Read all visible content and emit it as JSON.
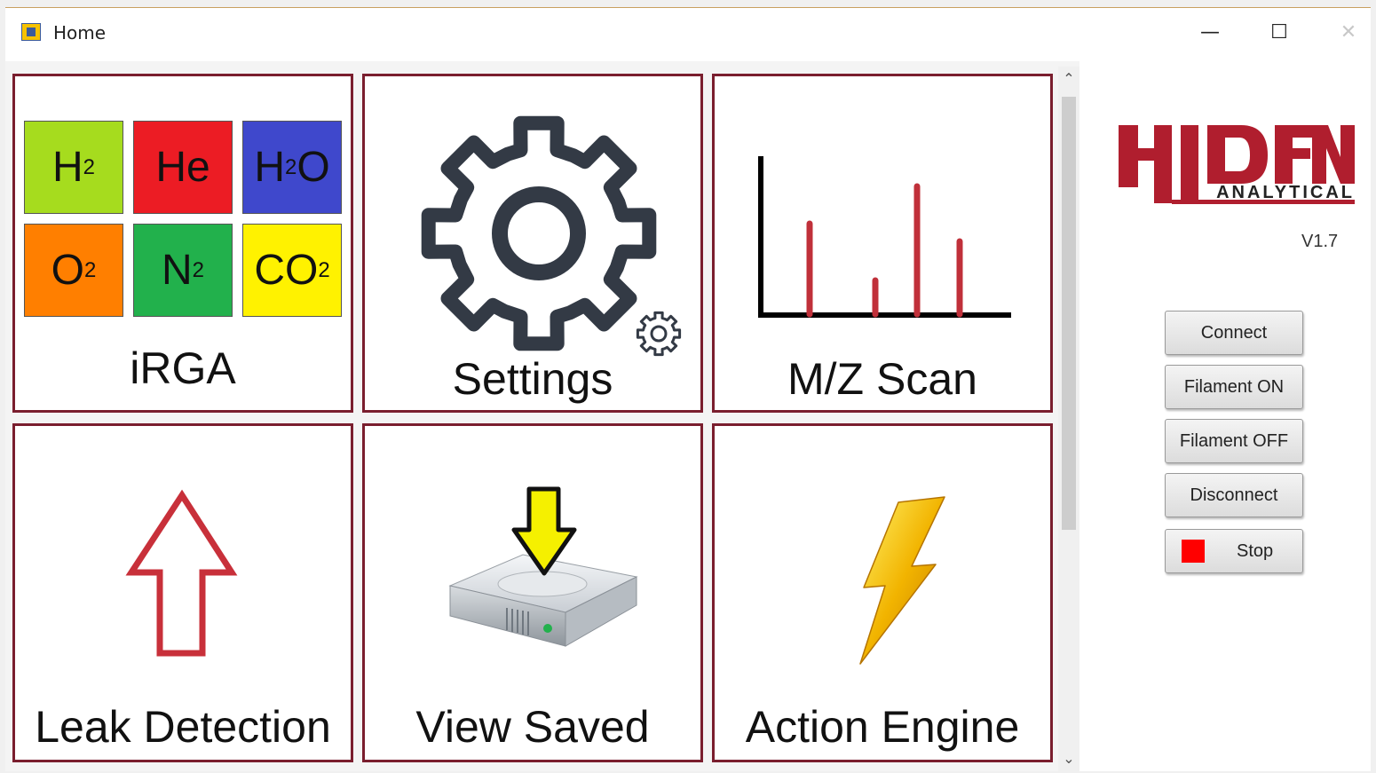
{
  "window": {
    "title": "Home"
  },
  "window_controls": {
    "minimize": "—",
    "maximize": "☐",
    "close": "✕"
  },
  "tiles": {
    "irga": {
      "label": "iRGA",
      "cells": [
        {
          "symbol": "H",
          "sub": "2",
          "tail": "",
          "color": "#a6dc1e"
        },
        {
          "symbol": "He",
          "sub": "",
          "tail": "",
          "color": "#ec1c24"
        },
        {
          "symbol": "H",
          "sub": "2",
          "tail": "O",
          "color": "#3f48cc"
        },
        {
          "symbol": "O",
          "sub": "2",
          "tail": "",
          "color": "#ff7f00"
        },
        {
          "symbol": "N",
          "sub": "2",
          "tail": "",
          "color": "#22b14c"
        },
        {
          "symbol": "CO",
          "sub": "2",
          "tail": "",
          "color": "#fff200"
        }
      ]
    },
    "settings": {
      "label": "Settings",
      "icon": "gear-icon"
    },
    "mz_scan": {
      "label": "M/Z Scan",
      "icon": "spectrum-chart-icon"
    },
    "leak_detection": {
      "label": "Leak Detection",
      "icon": "arrow-up-icon"
    },
    "view_saved": {
      "label": "View Saved",
      "icon": "hard-drive-icon"
    },
    "action_engine": {
      "label": "Action Engine",
      "icon": "lightning-bolt-icon"
    }
  },
  "scrollbar": {
    "up": "⌃",
    "down": "⌄"
  },
  "logo": {
    "name": "HIDEN",
    "subtitle": "ANALYTICAL",
    "brand_color": "#b01e2e"
  },
  "version": "V1.7",
  "buttons": {
    "connect": "Connect",
    "filament_on": "Filament ON",
    "filament_off": "Filament OFF",
    "disconnect": "Disconnect",
    "stop": "Stop"
  }
}
